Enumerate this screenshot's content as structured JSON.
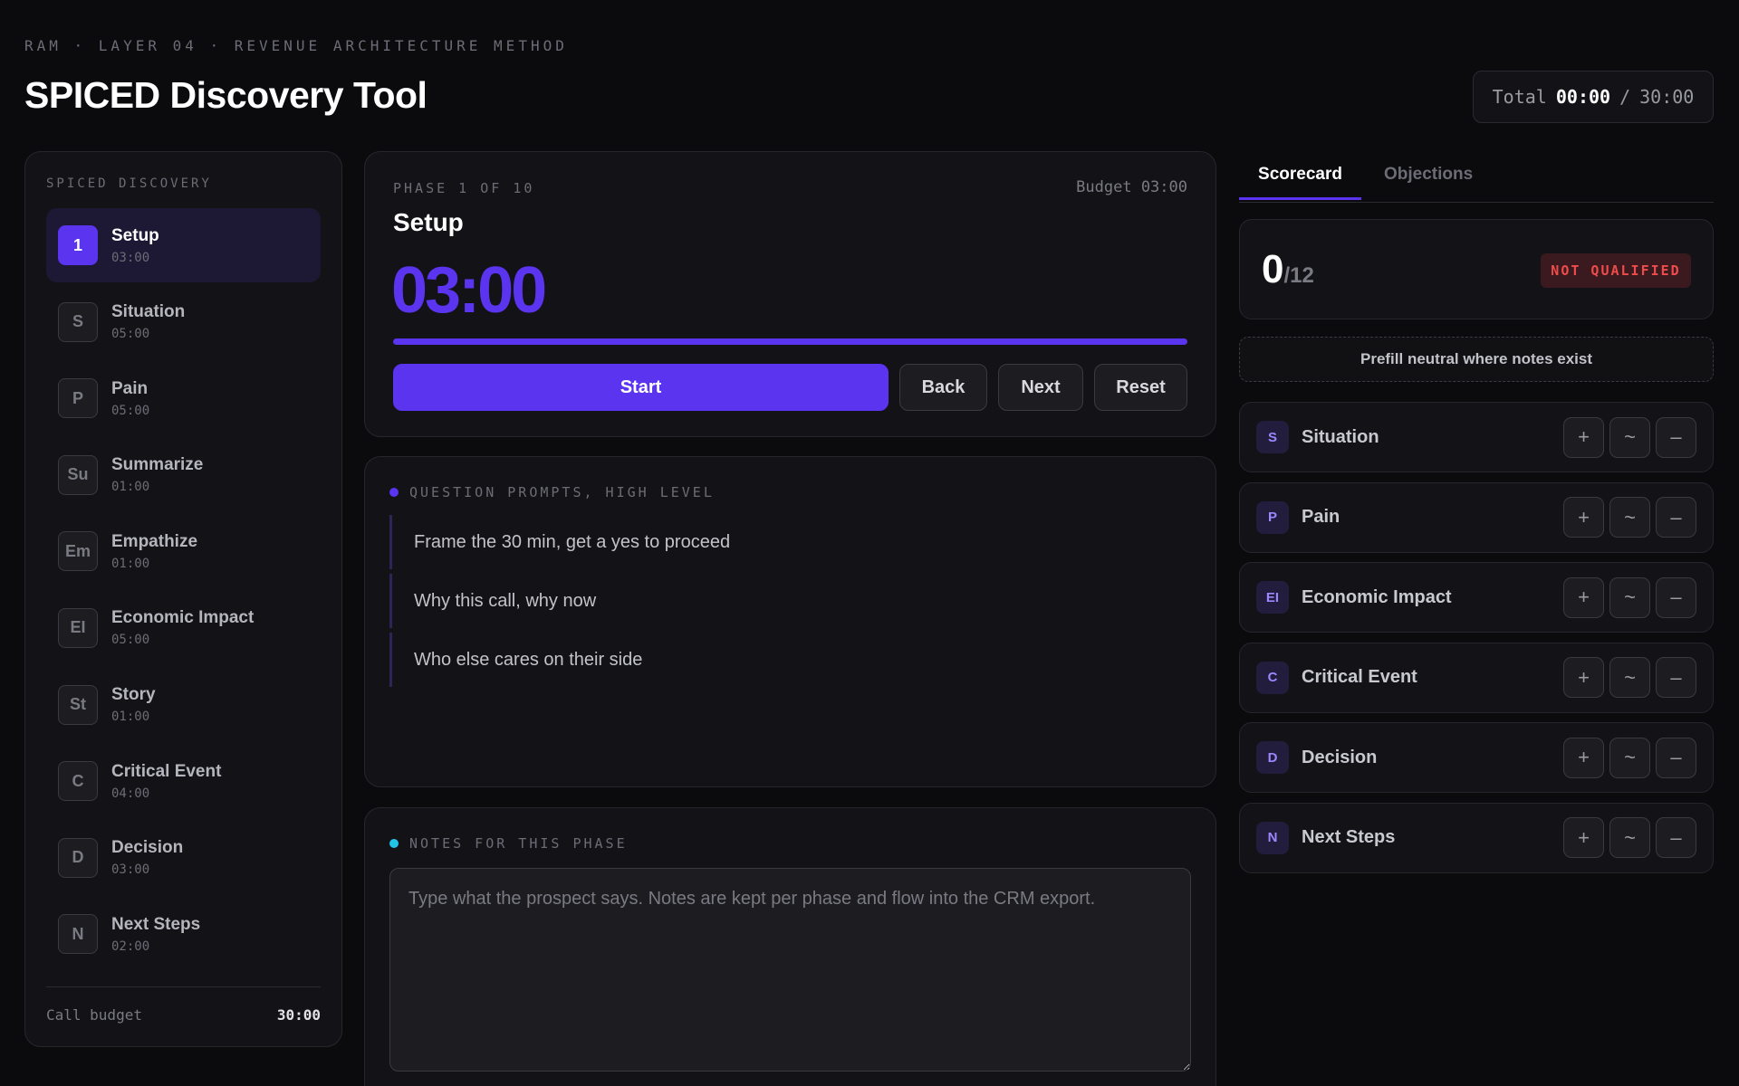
{
  "header": {
    "eyebrow": "RAM · LAYER 04 · REVENUE ARCHITECTURE METHOD",
    "title": "SPICED Discovery Tool",
    "total_label": "Total",
    "total_elapsed": "00:00",
    "total_separator": "/",
    "total_budget": "30:00"
  },
  "sidebar": {
    "heading": "SPICED DISCOVERY",
    "phases": [
      {
        "badge": "1",
        "name": "Setup",
        "time": "03:00",
        "active": true
      },
      {
        "badge": "S",
        "name": "Situation",
        "time": "05:00"
      },
      {
        "badge": "P",
        "name": "Pain",
        "time": "05:00"
      },
      {
        "badge": "Su",
        "name": "Summarize",
        "time": "01:00"
      },
      {
        "badge": "Em",
        "name": "Empathize",
        "time": "01:00"
      },
      {
        "badge": "EI",
        "name": "Economic Impact",
        "time": "05:00"
      },
      {
        "badge": "St",
        "name": "Story",
        "time": "01:00"
      },
      {
        "badge": "C",
        "name": "Critical Event",
        "time": "04:00"
      },
      {
        "badge": "D",
        "name": "Decision",
        "time": "03:00"
      },
      {
        "badge": "N",
        "name": "Next Steps",
        "time": "02:00"
      }
    ],
    "budget_label": "Call budget",
    "budget_value": "30:00"
  },
  "timer": {
    "phase_counter": "PHASE 1 OF 10",
    "budget": "Budget 03:00",
    "phase_title": "Setup",
    "display": "03:00",
    "progress": 1.0,
    "buttons": {
      "start": "Start",
      "back": "Back",
      "next": "Next",
      "reset": "Reset"
    }
  },
  "prompts": {
    "label": "QUESTION PROMPTS, HIGH LEVEL",
    "items": [
      "Frame the 30 min, get a yes to proceed",
      "Why this call, why now",
      "Who else cares on their side"
    ]
  },
  "notes": {
    "label": "NOTES FOR THIS PHASE",
    "placeholder": "Type what the prospect says. Notes are kept per phase and flow into the CRM export.",
    "value": ""
  },
  "tabs": {
    "scorecard": "Scorecard",
    "objections": "Objections",
    "active": "scorecard"
  },
  "scorecard": {
    "score": "0",
    "max": "/12",
    "status": "NOT QUALIFIED",
    "prefill_label": "Prefill neutral where notes exist",
    "criteria": [
      {
        "badge": "S",
        "name": "Situation"
      },
      {
        "badge": "P",
        "name": "Pain"
      },
      {
        "badge": "EI",
        "name": "Economic Impact"
      },
      {
        "badge": "C",
        "name": "Critical Event"
      },
      {
        "badge": "D",
        "name": "Decision"
      },
      {
        "badge": "N",
        "name": "Next Steps"
      }
    ],
    "button_symbols": {
      "plus": "+",
      "neutral": "~",
      "minus": "–"
    }
  },
  "colors": {
    "accent": "#5b34f0",
    "background": "#0b0b0e",
    "panel": "#131317",
    "danger": "#ef4b4b",
    "notes_dot": "#22c3e6"
  },
  "icons": {
    "prompts_dot": "bullet-dot-icon",
    "notes_dot": "bullet-dot-icon",
    "resize_handle": "resize-grip-icon"
  }
}
